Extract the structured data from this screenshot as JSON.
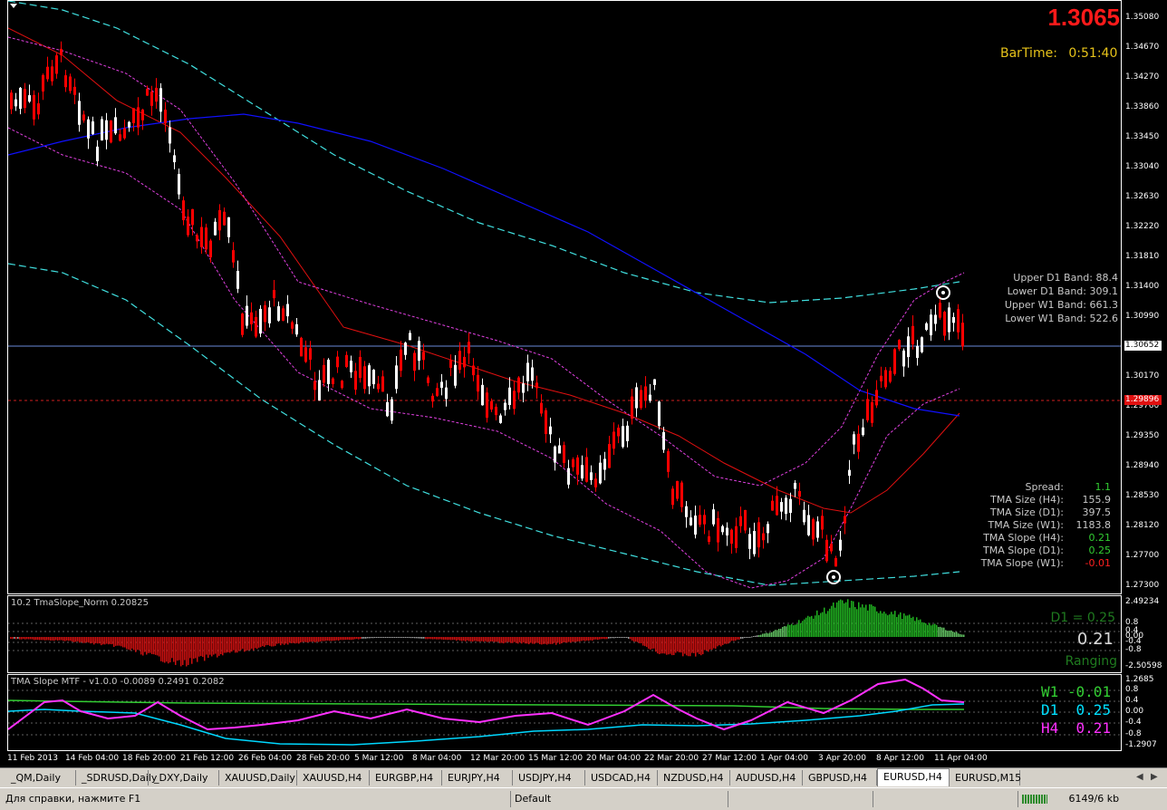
{
  "price_big": "1.3065",
  "bartime": {
    "label": "BarTime:",
    "value": "0:51:40"
  },
  "price_scale": [
    "1.35080",
    "1.34670",
    "1.34270",
    "1.33860",
    "1.33450",
    "1.33040",
    "1.32630",
    "1.32220",
    "1.31810",
    "1.31400",
    "1.30990",
    "1.30170",
    "1.29760",
    "1.29350",
    "1.28940",
    "1.28530",
    "1.28120",
    "1.27700",
    "1.27300"
  ],
  "current_price_tag": "1.30652",
  "red_line_tag": "1.29896",
  "band_labels": [
    {
      "label": "Upper D1 Band:",
      "value": "88.4"
    },
    {
      "label": "Lower D1 Band:",
      "value": "309.1"
    },
    {
      "label": "Upper W1 Band:",
      "value": "661.3"
    },
    {
      "label": "Lower W1 Band:",
      "value": "522.6"
    }
  ],
  "stats": [
    {
      "label": "Spread:",
      "value": "1.1",
      "color": "#32cd32"
    },
    {
      "label": "TMA Size (H4):",
      "value": "155.9",
      "color": "#c8c8c8"
    },
    {
      "label": "TMA Size (D1):",
      "value": "397.5",
      "color": "#c8c8c8"
    },
    {
      "label": "TMA Size (W1):",
      "value": "1183.8",
      "color": "#c8c8c8"
    },
    {
      "label": "TMA Slope (H4):",
      "value": "0.21",
      "color": "#32cd32"
    },
    {
      "label": "TMA Slope (D1):",
      "value": "0.25",
      "color": "#32cd32"
    },
    {
      "label": "TMA Slope (W1):",
      "value": "-0.01",
      "color": "#ff2020"
    }
  ],
  "indicator1": {
    "title": "10.2 TmaSlope_Norm 0.20825",
    "scale": [
      "2.49234",
      "0.8",
      "0.4",
      "0.00",
      "-0.4",
      "-0.8",
      "-2.50598"
    ],
    "d1_text": "D1 = 0.25",
    "value_text": "0.21",
    "state_text": "Ranging"
  },
  "indicator2": {
    "title": "TMA Slope MTF - v1.0.0 -0.0089 0.2491 0.2082",
    "scale": [
      "1.2685",
      "0.8",
      "0.4",
      "0.00",
      "-0.4",
      "-0.8",
      "-1.2907"
    ],
    "w1": {
      "label": "W1",
      "value": "-0.01"
    },
    "d1": {
      "label": "D1",
      "value": "0.25"
    },
    "h4": {
      "label": "H4",
      "value": "0.21"
    }
  },
  "time_axis": [
    "11 Feb 2013",
    "14 Feb 04:00",
    "18 Feb 20:00",
    "21 Feb 12:00",
    "26 Feb 04:00",
    "28 Feb 20:00",
    "5 Mar 12:00",
    "8 Mar 04:00",
    "12 Mar 20:00",
    "15 Mar 12:00",
    "20 Mar 04:00",
    "22 Mar 20:00",
    "27 Mar 12:00",
    "1 Apr 04:00",
    "3 Apr 20:00",
    "8 Apr 12:00",
    "11 Apr 04:00"
  ],
  "tabs": [
    "_QM,Daily",
    "_SDRUSD,Daily",
    "_DXY,Daily",
    "XAUUSD,Daily",
    "XAUUSD,H4",
    "EURGBP,H4",
    "EURJPY,H4",
    "USDJPY,H4",
    "USDCAD,H4",
    "NZDUSD,H4",
    "AUDUSD,H4",
    "GBPUSD,H4",
    "EURUSD,H4",
    "EURUSD,M15"
  ],
  "active_tab": "EURUSD,H4",
  "status": {
    "help": "Для справки, нажмите F1",
    "profile": "Default",
    "traffic": "6149/6 kb"
  },
  "colors": {
    "bull": "#ffffff",
    "bear": "#ff0000",
    "tma_h4": "#e01010",
    "band_h4": "#e040e0",
    "band_d1": "#40e0e0",
    "tma_w1": "#1010ff"
  }
}
